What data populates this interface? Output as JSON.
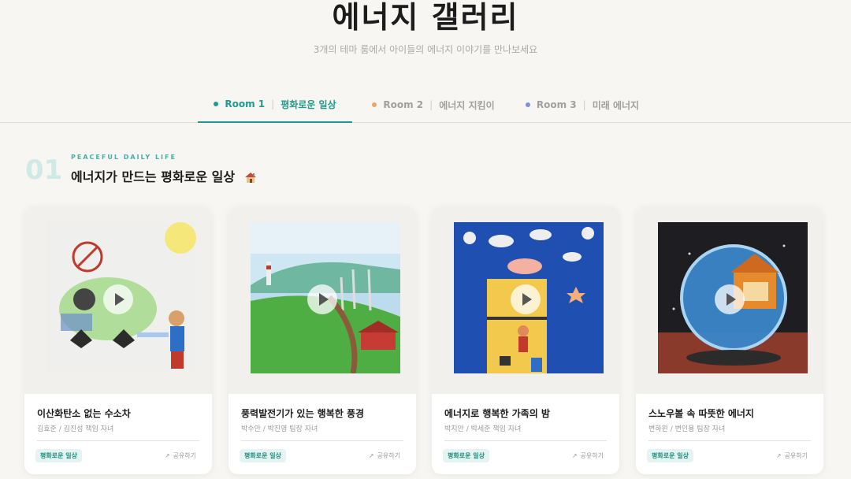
{
  "header": {
    "title": "에너지 갤러리",
    "subtitle": "3개의 테마 룸에서 아이들의 에너지 이야기를 만나보세요"
  },
  "tabs": [
    {
      "room": "Room 1",
      "name": "평화로운 일상",
      "dot_color": "#1e9a8e",
      "active": true
    },
    {
      "room": "Room 2",
      "name": "에너지 지킴이",
      "dot_color": "#f0a36b",
      "active": false
    },
    {
      "room": "Room 3",
      "name": "미래 에너지",
      "dot_color": "#7d8fe0",
      "active": false
    }
  ],
  "section": {
    "number": "01",
    "eyebrow": "PEACEFUL DAILY LIFE",
    "title": "에너지가 만드는 평화로운 일상",
    "title_icon": "house-icon"
  },
  "cards": [
    {
      "title": "이산화탄소 없는 수소차",
      "author": "김효준 / 김진성 책임 자녀",
      "badge": "평화로운 일상",
      "share": "공유하기"
    },
    {
      "title": "풍력발전기가 있는 행복한 풍경",
      "author": "박수안 / 박진영 팀장 자녀",
      "badge": "평화로운 일상",
      "share": "공유하기"
    },
    {
      "title": "에너지로 행복한 가족의 밤",
      "author": "박지안 / 박세준 책임 자녀",
      "badge": "평화로운 일상",
      "share": "공유하기"
    },
    {
      "title": "스노우볼 속 따뜻한 에너지",
      "author": "변하윈 / 변인용 팀장 자녀",
      "badge": "평화로운 일상",
      "share": "공유하기"
    }
  ],
  "colors": {
    "accent": "#1e9a8e",
    "background": "#f7f6f3"
  }
}
